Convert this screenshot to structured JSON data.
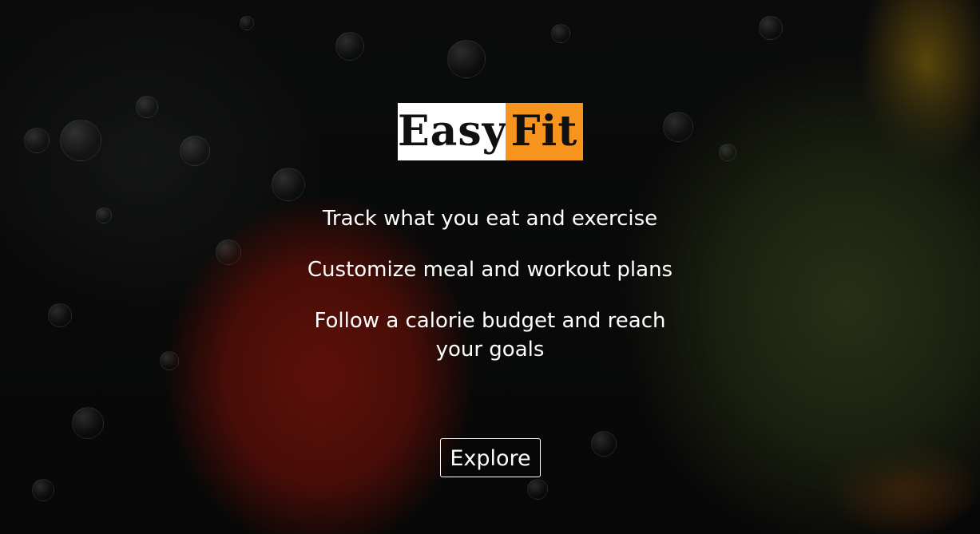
{
  "brand": {
    "part1": "Easy",
    "part2": "Fit",
    "colors": {
      "part1_bg": "#ffffff",
      "part2_bg": "#f7941d",
      "text": "#111111"
    }
  },
  "features": [
    "Track what you eat and exercise",
    "Customize meal and workout plans",
    "Follow a calorie budget and reach your goals"
  ],
  "cta": {
    "label": "Explore"
  },
  "background": {
    "icon": "vegetables-in-water-photo"
  }
}
